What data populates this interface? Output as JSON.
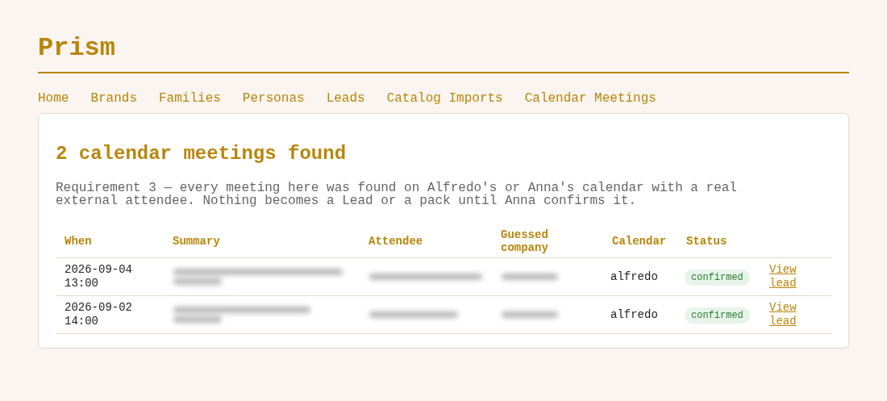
{
  "app_title": "Prism",
  "nav": [
    "Home",
    "Brands",
    "Families",
    "Personas",
    "Leads",
    "Catalog Imports",
    "Calendar Meetings"
  ],
  "heading": "2 calendar meetings found",
  "description": "Requirement 3 — every meeting here was found on Alfredo's or Anna's calendar with a real external attendee. Nothing becomes a Lead or a pack until Anna confirms it.",
  "table": {
    "columns": [
      "When",
      "Summary",
      "Attendee",
      "Guessed company",
      "Calendar",
      "Status"
    ],
    "rows": [
      {
        "when": "2026-09-04 13:00",
        "calendar": "alfredo",
        "status": "confirmed",
        "link": "View lead"
      },
      {
        "when": "2026-09-02 14:00",
        "calendar": "alfredo",
        "status": "confirmed",
        "link": "View lead"
      }
    ]
  }
}
